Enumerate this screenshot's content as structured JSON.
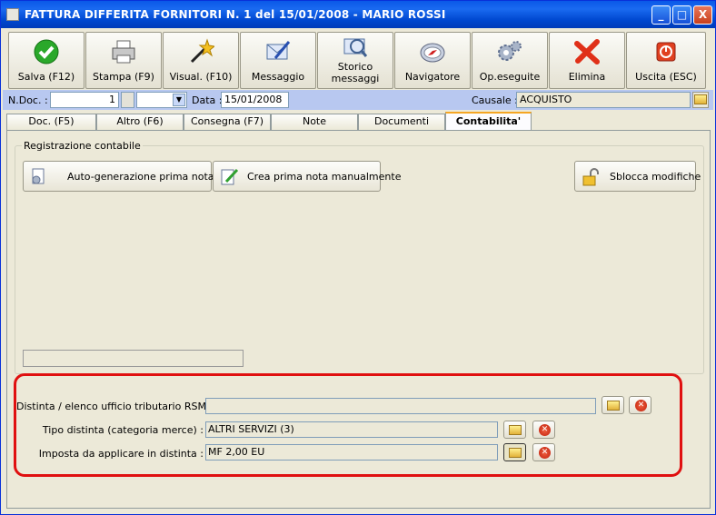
{
  "window": {
    "title": "FATTURA DIFFERITA FORNITORI N. 1   del 15/01/2008 - MARIO ROSSI",
    "controls": [
      "_",
      "□",
      "X"
    ]
  },
  "toolbar": {
    "buttons": [
      {
        "label": "Salva (F12)",
        "icon": "save-check-icon"
      },
      {
        "label": "Stampa (F9)",
        "icon": "printer-icon"
      },
      {
        "label": "Visual. (F10)",
        "icon": "magic-wand-icon"
      },
      {
        "label": "Messaggio",
        "icon": "message-pen-icon"
      },
      {
        "label_line1": "Storico",
        "label_line2": "messaggi",
        "icon": "message-history-icon"
      },
      {
        "label": "Navigatore",
        "icon": "compass-icon"
      },
      {
        "label": "Op.eseguite",
        "icon": "gears-icon"
      },
      {
        "label": "Elimina",
        "icon": "delete-x-icon"
      },
      {
        "label": "Uscita (ESC)",
        "icon": "power-exit-icon"
      }
    ]
  },
  "docbar": {
    "ndoc_label": "N.Doc. :",
    "ndoc_value": "1",
    "data_label": "Data :",
    "data_value": "15/01/2008",
    "causale_label": "Causale :",
    "causale_value": "ACQUISTO"
  },
  "tabs": [
    "Doc. (F5)",
    "Altro (F6)",
    "Consegna (F7)",
    "Note",
    "Documenti",
    "Contabilita'"
  ],
  "active_tab": "Contabilita'",
  "registrazione": {
    "group_label": "Registrazione contabile",
    "auto_button": "Auto-generazione prima nota",
    "manual_button": "Crea prima nota manualmente",
    "unlock_button": "Sblocca modifiche"
  },
  "bottom": {
    "distinta_label": "Distinta / elenco ufficio tributario RSM :",
    "distinta_value": "",
    "tipo_label": "Tipo distinta (categoria merce) :",
    "tipo_value": "ALTRI SERVIZI (3)",
    "imposta_label": "Imposta da applicare in distinta :",
    "imposta_value": "MF 2,00 EU"
  },
  "colors": {
    "titlebar": "#0a58e8",
    "docbar": "#b8c8f0",
    "highlight": "#e01010",
    "active_tab_accent": "#f5a623"
  }
}
